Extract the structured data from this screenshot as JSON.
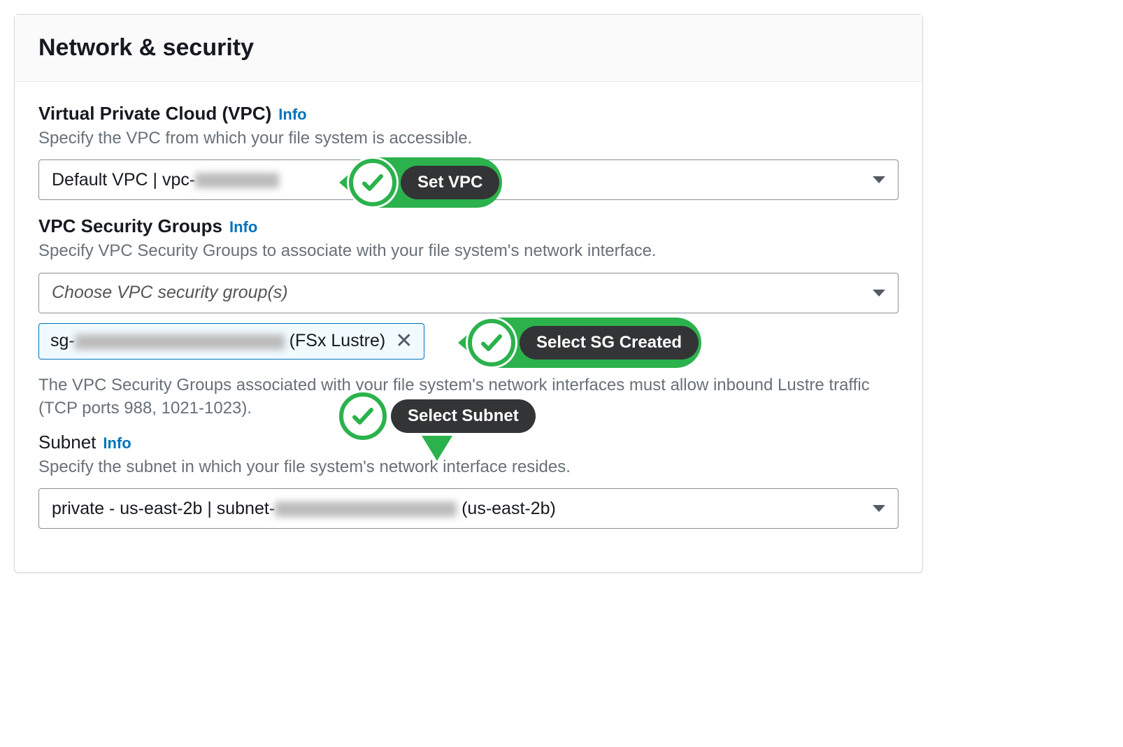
{
  "panel": {
    "title": "Network & security"
  },
  "vpc": {
    "label": "Virtual Private Cloud (VPC)",
    "info": "Info",
    "desc": "Specify the VPC from which your file system is accessible.",
    "value_prefix": "Default VPC | vpc-",
    "value_hidden": "redacted"
  },
  "sg": {
    "label": "VPC Security Groups",
    "info": "Info",
    "desc": "Specify VPC Security Groups to associate with your file system's network interface.",
    "placeholder": "Choose VPC security group(s)",
    "token_prefix": "sg-",
    "token_hidden": "redacted",
    "token_suffix": " (FSx Lustre)",
    "help": "The VPC Security Groups associated with your file system's network interfaces must allow inbound Lustre traffic (TCP ports 988, 1021-1023)."
  },
  "subnet": {
    "label": "Subnet",
    "info": "Info",
    "desc": "Specify the subnet in which your file system's network interface resides.",
    "value_prefix": "private - us-east-2b | subnet-",
    "value_hidden": "redacted",
    "value_suffix": " (us-east-2b)"
  },
  "annotations": {
    "set_vpc": "Set VPC",
    "select_sg": "Select SG Created",
    "select_subnet": "Select Subnet"
  }
}
